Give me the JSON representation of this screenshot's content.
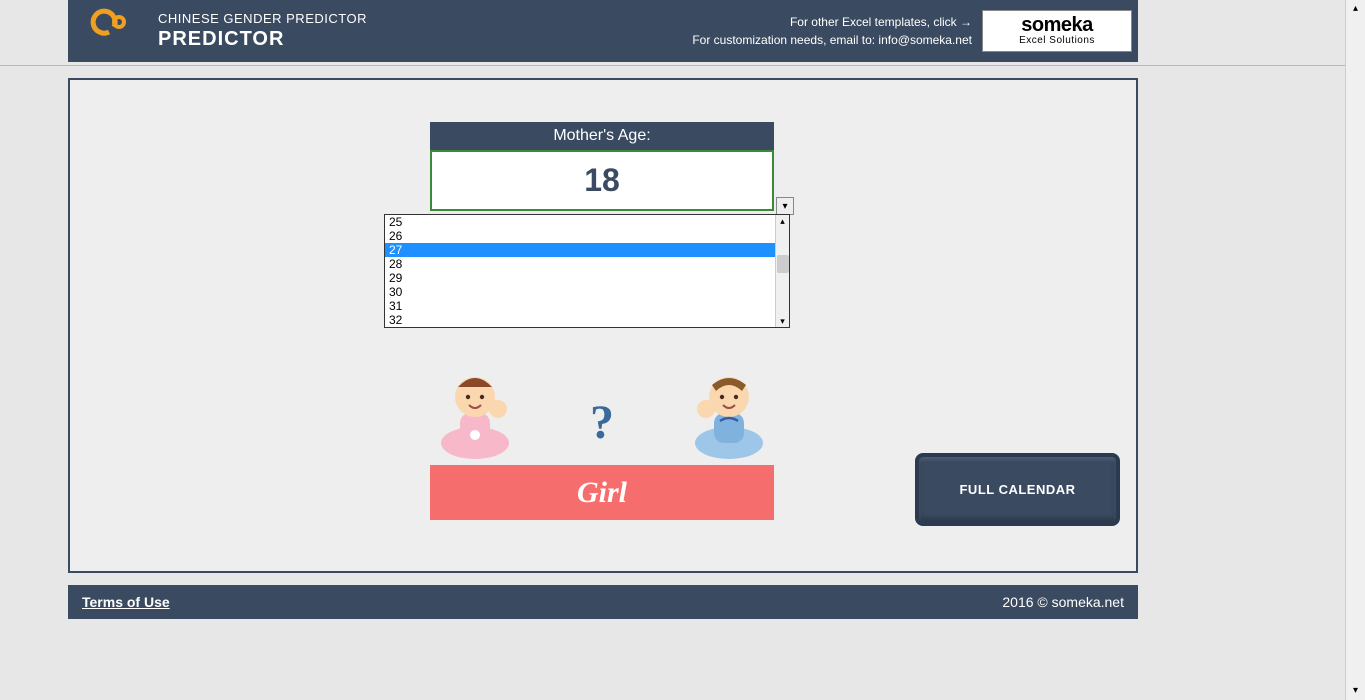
{
  "header": {
    "small_title": "CHINESE GENDER PREDICTOR",
    "big_title": "PREDICTOR",
    "other_templates": "For other Excel templates, click →",
    "customization": "For customization needs, email to: info@someka.net",
    "brand_name": "someka",
    "brand_tag": "Excel Solutions"
  },
  "age": {
    "label": "Mother's Age:",
    "value": "18"
  },
  "dropdown": {
    "options": [
      "25",
      "26",
      "27",
      "28",
      "29",
      "30",
      "31",
      "32"
    ],
    "selected_index": 2
  },
  "result": {
    "label": "Girl"
  },
  "full_calendar": {
    "label": "FULL CALENDAR"
  },
  "footer": {
    "terms": "Terms of Use",
    "copyright": "2016 © someka.net"
  },
  "qmark": "?"
}
